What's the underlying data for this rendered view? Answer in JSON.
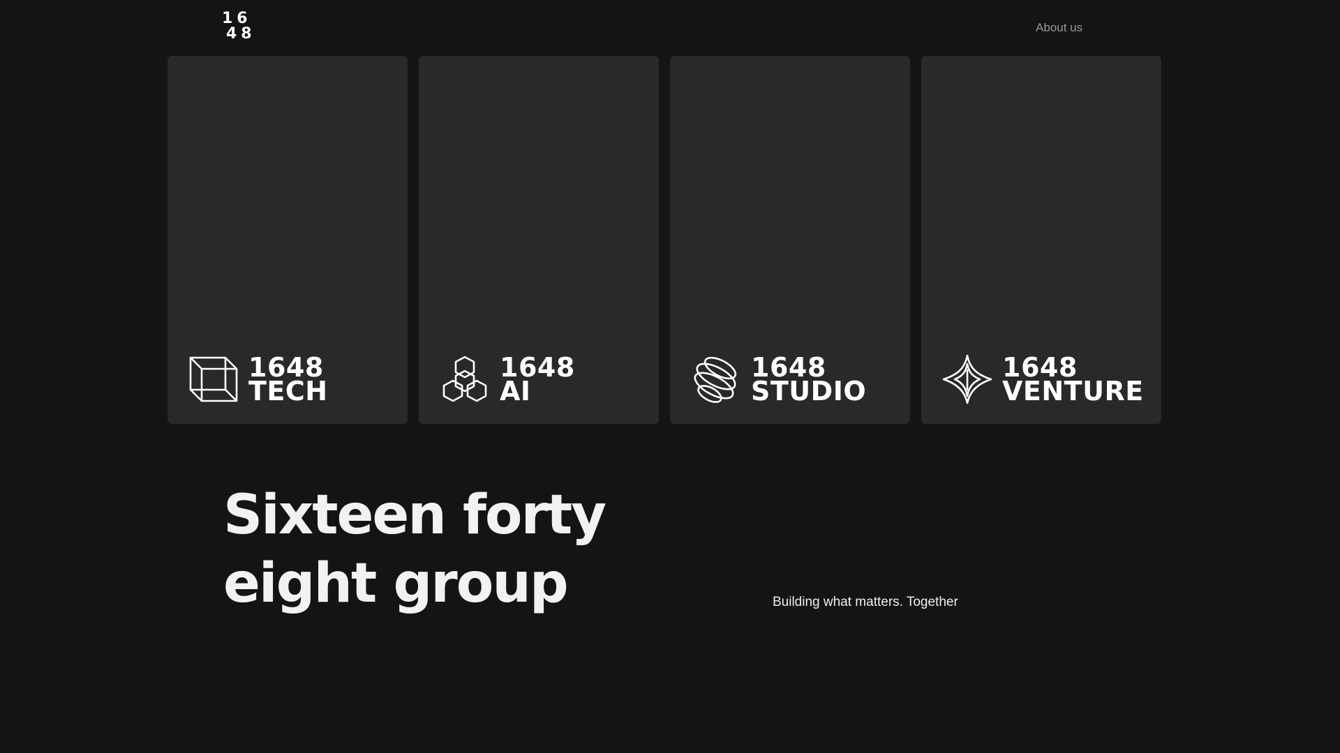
{
  "header": {
    "logo_line1": "16",
    "logo_line2": "48",
    "about_link": "About us"
  },
  "cards": [
    {
      "line1": "1648",
      "line2": "TECH",
      "icon": "wireframe-cube-icon"
    },
    {
      "line1": "1648",
      "line2": "AI",
      "icon": "hexagon-cluster-icon"
    },
    {
      "line1": "1648",
      "line2": "STUDIO",
      "icon": "stacked-rings-icon"
    },
    {
      "line1": "1648",
      "line2": "VENTURE",
      "icon": "diamond-star-icon"
    }
  ],
  "hero": {
    "title_line1": "Sixteen forty",
    "title_line2": "eight group",
    "tagline": "Building what matters. Together"
  },
  "colors": {
    "background": "#141414",
    "card": "#2a2928",
    "text": "#ffffff",
    "nav_text": "#9b9b9b"
  }
}
